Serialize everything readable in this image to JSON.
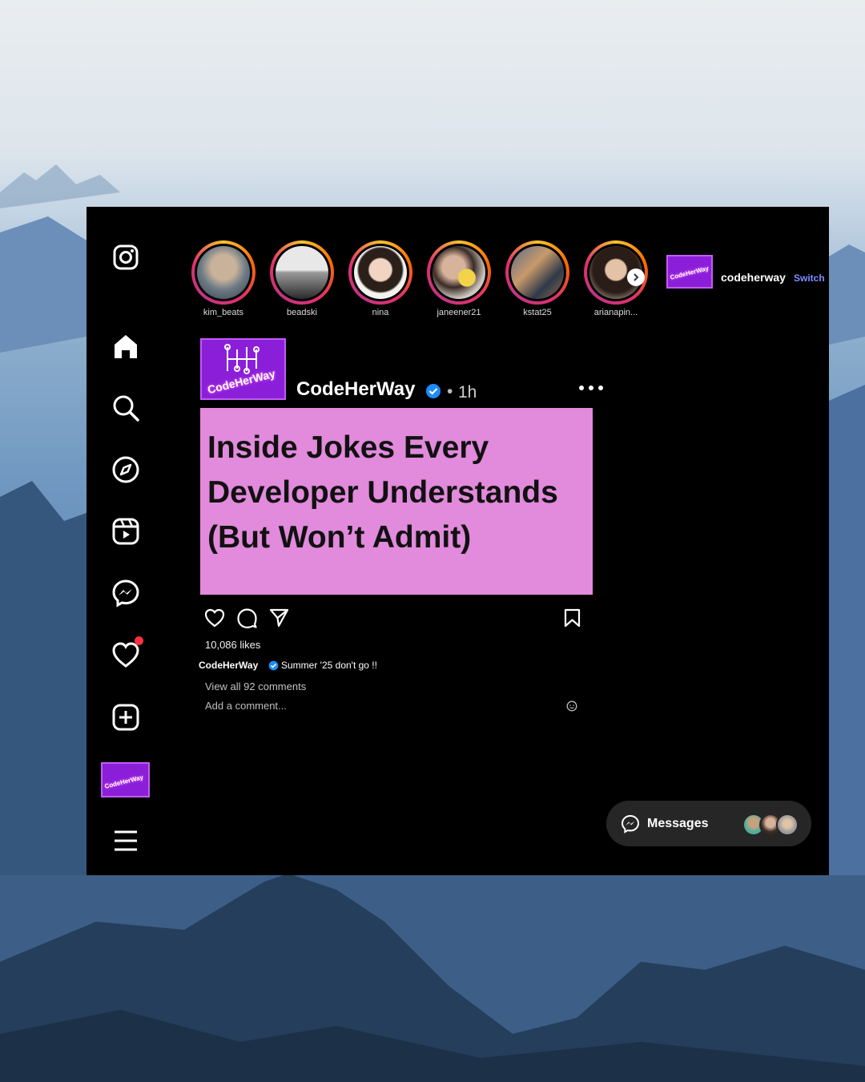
{
  "profile": {
    "username": "codeherway",
    "switch_label": "Switch"
  },
  "stories": [
    {
      "name": "kim_beats"
    },
    {
      "name": "beadski"
    },
    {
      "name": "nina"
    },
    {
      "name": "janeener21"
    },
    {
      "name": "kstat25"
    },
    {
      "name": "arianapin..."
    }
  ],
  "post": {
    "author": "CodeHerWay",
    "time": "1h",
    "title_lines": [
      "Inside Jokes Every",
      "Developer Understands",
      "(But Won’t Admit)"
    ],
    "likes": "10,086 likes",
    "caption_author": "CodeHerWay",
    "caption": "Summer '25 don't go !!",
    "view_comments": "View all 92 comments",
    "comment_placeholder": "Add a comment..."
  },
  "messages": {
    "label": "Messages"
  },
  "brand": {
    "logo_text": "CodeHerWay"
  },
  "colors": {
    "accent_link": "#7f8cff",
    "post_bg": "#e28adc",
    "notif": "#ff3040",
    "verified": "#1d8cf8"
  }
}
